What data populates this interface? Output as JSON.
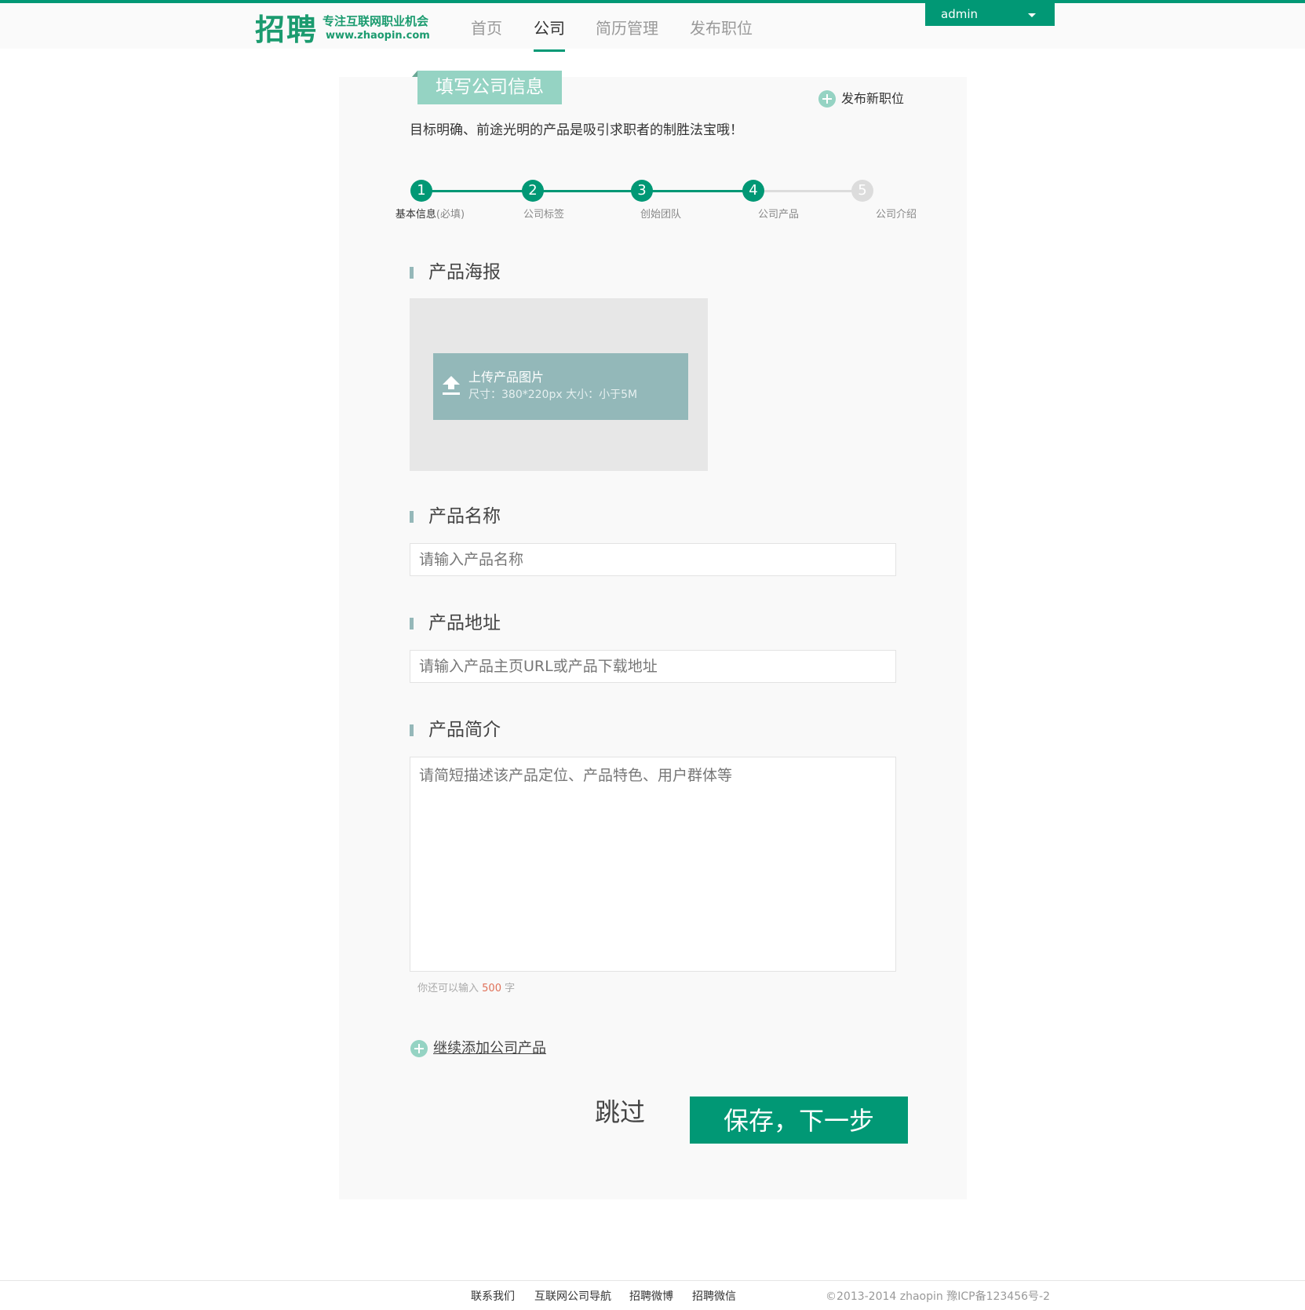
{
  "header": {
    "logo": {
      "big": "招聘",
      "tagline": "专注互联网职业机会",
      "url": "www.zhaopin.com"
    },
    "nav": [
      {
        "label": "首页",
        "active": false
      },
      {
        "label": "公司",
        "active": true
      },
      {
        "label": "简历管理",
        "active": false
      },
      {
        "label": "发布职位",
        "active": false
      }
    ],
    "user": {
      "name": "admin"
    }
  },
  "panel": {
    "title": "填写公司信息",
    "add_job_label": "发布新职位",
    "intro": "目标明确、前途光明的产品是吸引求职者的制胜法宝哦！",
    "steps": [
      {
        "number": "1",
        "label": "基本信息",
        "note": "(必填)",
        "done": true
      },
      {
        "number": "2",
        "label": "公司标签",
        "note": "",
        "done": true
      },
      {
        "number": "3",
        "label": "创始团队",
        "note": "",
        "done": true
      },
      {
        "number": "4",
        "label": "公司产品",
        "note": "",
        "done": true
      },
      {
        "number": "5",
        "label": "公司介绍",
        "note": "",
        "done": false
      }
    ]
  },
  "form": {
    "poster": {
      "title": "产品海报",
      "upload_label": "上传产品图片",
      "upload_hint": "尺寸：380*220px 大小：小于5M"
    },
    "name": {
      "title": "产品名称",
      "placeholder": "请输入产品名称",
      "value": ""
    },
    "address": {
      "title": "产品地址",
      "placeholder": "请输入产品主页URL或产品下载地址",
      "value": ""
    },
    "intro": {
      "title": "产品简介",
      "placeholder": "请简短描述该产品定位、产品特色、用户群体等",
      "value": "",
      "counter_prefix": "你还可以输入",
      "counter_number": "500",
      "counter_suffix": "字"
    },
    "add_more_label": "继续添加公司产品",
    "skip_label": "跳过",
    "save_label": "保存，下一步"
  },
  "footer": {
    "links": [
      "联系我们",
      "互联网公司导航",
      "招聘微博",
      "招聘微信"
    ],
    "copyright": "©2013-2014 zhaopin    豫ICP备123456号-2"
  },
  "colors": {
    "brand": "#019875",
    "tab": "#95d3c3",
    "upload": "#93b8b9",
    "counter_number": "#e07159"
  }
}
